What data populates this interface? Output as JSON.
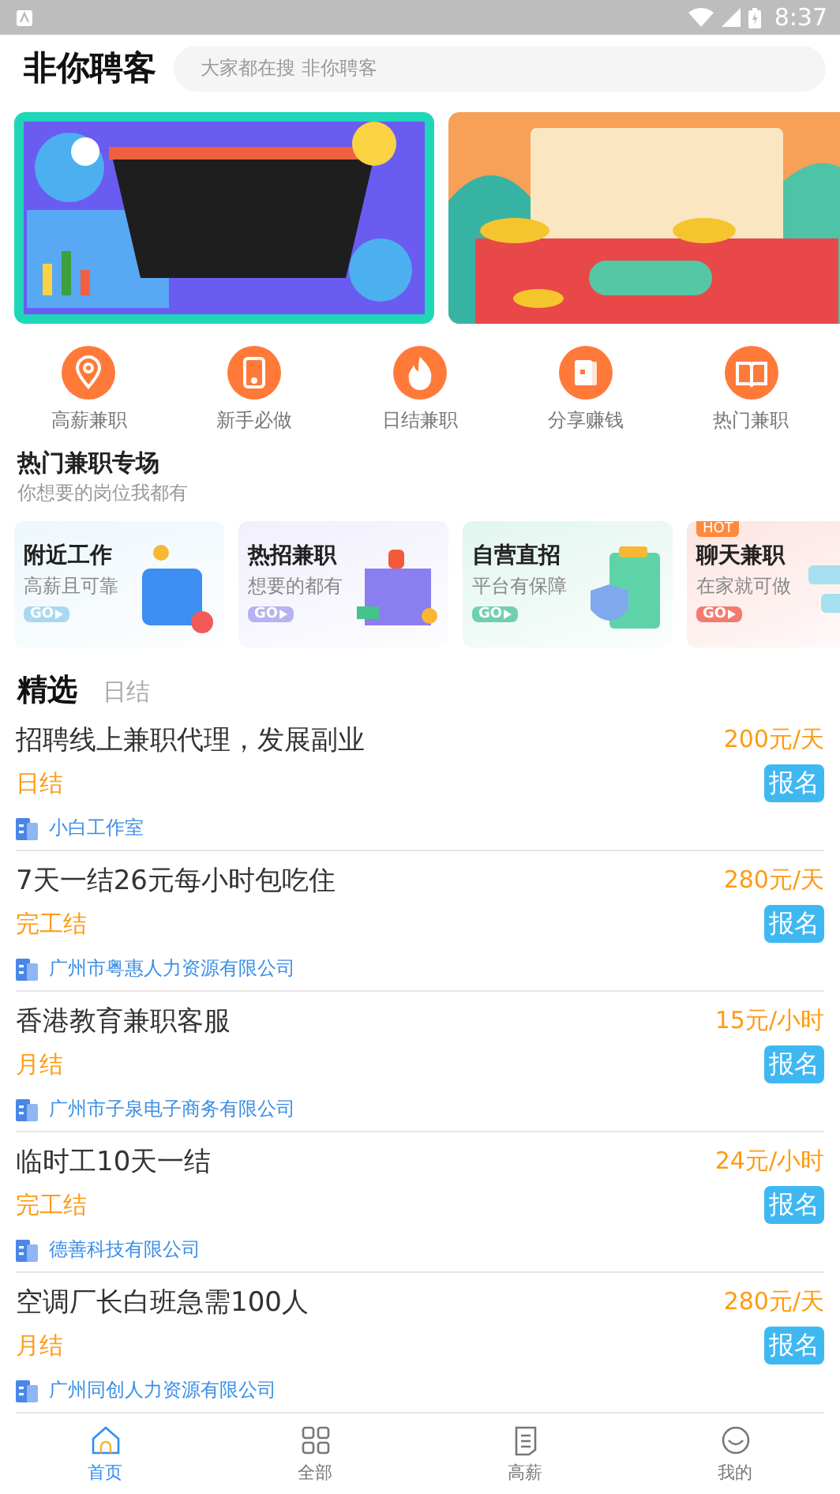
{
  "status_bar": {
    "time": "8:37"
  },
  "header": {
    "title": "非你聘客",
    "search": {
      "placeholder": "大家都在搜 非你聘客"
    }
  },
  "shortcuts": [
    {
      "label": "高薪兼职"
    },
    {
      "label": "新手必做"
    },
    {
      "label": "日结兼职"
    },
    {
      "label": "分享赚钱"
    },
    {
      "label": "热门兼职"
    }
  ],
  "section": {
    "title": "热门兼职专场",
    "subtitle": "你想要的岗位我都有"
  },
  "categories": [
    {
      "title": "附近工作",
      "subtitle": "高薪且可靠",
      "go": "GO",
      "color": "#a9d8f0"
    },
    {
      "title": "热招兼职",
      "subtitle": "想要的都有",
      "go": "GO",
      "color": "#b7b2f2"
    },
    {
      "title": "自营直招",
      "subtitle": "平台有保障",
      "go": "GO",
      "color": "#6fd0b0"
    },
    {
      "title": "聊天兼职",
      "subtitle": "在家就可做",
      "go": "GO",
      "color": "#f47a6e",
      "hot": "HOT"
    }
  ],
  "list_tabs": [
    {
      "label": "精选",
      "selected": true
    },
    {
      "label": "日结",
      "selected": false
    }
  ],
  "jobs": [
    {
      "title": "招聘线上兼职代理，发展副业",
      "pay": "200元/天",
      "settlement": "日结",
      "action": "报名",
      "company": "小白工作室"
    },
    {
      "title": "7天一结26元每小时包吃住",
      "pay": "280元/天",
      "settlement": "完工结",
      "action": "报名",
      "company": "广州市粤惠人力资源有限公司"
    },
    {
      "title": "香港教育兼职客服",
      "pay": "15元/小时",
      "settlement": "月结",
      "action": "报名",
      "company": "广州市子泉电子商务有限公司"
    },
    {
      "title": "临时工10天一结",
      "pay": "24元/小时",
      "settlement": "完工结",
      "action": "报名",
      "company": "德善科技有限公司"
    },
    {
      "title": "空调厂长白班急需100人",
      "pay": "280元/天",
      "settlement": "月结",
      "action": "报名",
      "company": "广州同创人力资源有限公司"
    }
  ],
  "bottom_nav": [
    {
      "label": "首页",
      "selected": true
    },
    {
      "label": "全部",
      "selected": false
    },
    {
      "label": "高薪",
      "selected": false
    },
    {
      "label": "我的",
      "selected": false
    }
  ]
}
